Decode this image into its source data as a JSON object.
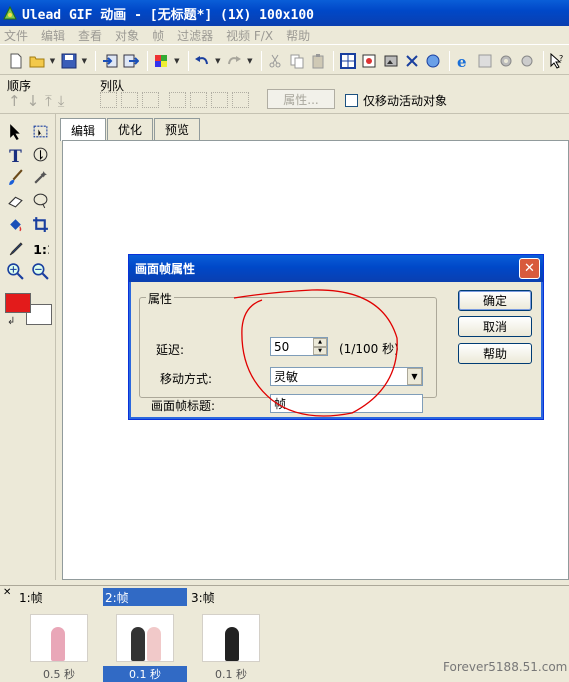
{
  "window": {
    "title": "Ulead GIF 动画 - [无标题*] (1X) 100x100"
  },
  "menu": [
    "文件",
    "编辑",
    "查看",
    "对象",
    "帧",
    "过滤器",
    "视频 F/X",
    "帮助"
  ],
  "toolbar2": {
    "order_label": "顺序",
    "queue_label": "列队",
    "properties_button": "属性...",
    "move_active_only_label": "仅移动活动对象"
  },
  "tabs": [
    "编辑",
    "优化",
    "预览"
  ],
  "dialog": {
    "title": "画面帧属性",
    "group_label": "属性",
    "delay_label": "延迟:",
    "delay_value": "50",
    "delay_unit": "(1/100 秒)",
    "move_method_label": "移动方式:",
    "move_method_value": "灵敏",
    "frame_title_label": "画面帧标题:",
    "frame_title_value": "帧",
    "ok_button": "确定",
    "cancel_button": "取消",
    "help_button": "帮助"
  },
  "frames": [
    {
      "label": "1:帧",
      "delay": "0.5 秒",
      "selected": false
    },
    {
      "label": "2:帧",
      "delay": "0.1 秒",
      "selected": true
    },
    {
      "label": "3:帧",
      "delay": "0.1 秒",
      "selected": false
    }
  ],
  "watermark": "Forever5188.51.com",
  "colors": {
    "title_blue": "#0048c8",
    "foreground": "#e31b1b",
    "background": "#ffffff",
    "annotation": "#e00000"
  }
}
